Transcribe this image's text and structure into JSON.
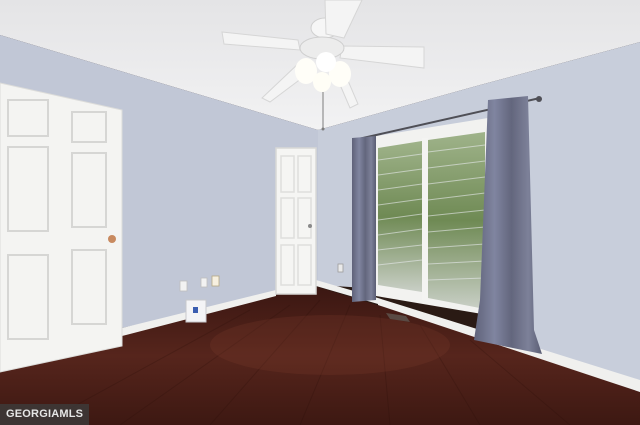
{
  "watermark": {
    "text": "GEORGIAMLS"
  },
  "colors": {
    "ceiling": "#ededed",
    "wall_left": "#c2c8d6",
    "wall_back": "#c6ccda",
    "wall_right": "#c7cdda",
    "floor": "#4a1f18",
    "door": "#f3f3f1",
    "curtain": "#75788f",
    "baseboard": "#f0f0ee"
  }
}
